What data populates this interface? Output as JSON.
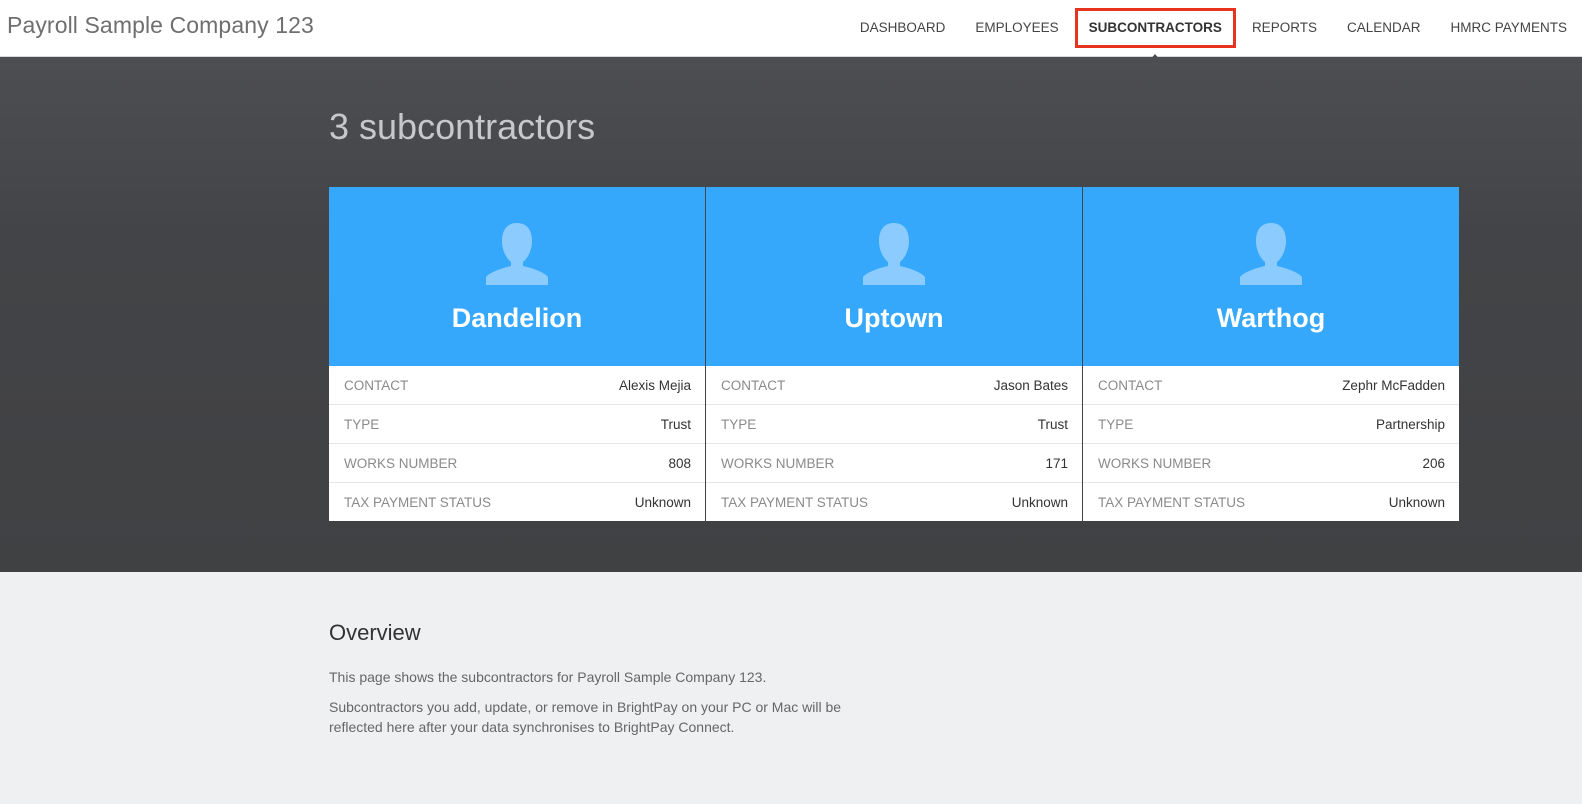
{
  "header": {
    "company_title": "Payroll Sample Company 123",
    "nav": [
      {
        "label": "DASHBOARD"
      },
      {
        "label": "EMPLOYEES"
      },
      {
        "label": "SUBCONTRACTORS"
      },
      {
        "label": "REPORTS"
      },
      {
        "label": "CALENDAR"
      },
      {
        "label": "HMRC PAYMENTS"
      }
    ],
    "active_nav": "SUBCONTRACTORS"
  },
  "main": {
    "heading": "3 subcontractors",
    "avatar_icon": "user-silhouette-icon",
    "cards": [
      {
        "name": "Dandelion",
        "rows": [
          {
            "label": "CONTACT",
            "value": "Alexis Mejia"
          },
          {
            "label": "TYPE",
            "value": "Trust"
          },
          {
            "label": "WORKS NUMBER",
            "value": "808"
          },
          {
            "label": "TAX PAYMENT STATUS",
            "value": "Unknown"
          }
        ]
      },
      {
        "name": "Uptown",
        "rows": [
          {
            "label": "CONTACT",
            "value": "Jason Bates"
          },
          {
            "label": "TYPE",
            "value": "Trust"
          },
          {
            "label": "WORKS NUMBER",
            "value": "171"
          },
          {
            "label": "TAX PAYMENT STATUS",
            "value": "Unknown"
          }
        ]
      },
      {
        "name": "Warthog",
        "rows": [
          {
            "label": "CONTACT",
            "value": "Zephr McFadden"
          },
          {
            "label": "TYPE",
            "value": "Partnership"
          },
          {
            "label": "WORKS NUMBER",
            "value": "206"
          },
          {
            "label": "TAX PAYMENT STATUS",
            "value": "Unknown"
          }
        ]
      }
    ]
  },
  "overview": {
    "title": "Overview",
    "paragraph_1": "This page shows the subcontractors for Payroll Sample Company 123.",
    "paragraph_2": "Subcontractors you add, update, or remove in BrightPay on your PC or Mac will be reflected here after your data synchronises to BrightPay Connect."
  },
  "colors": {
    "card_header": "#36a8fc",
    "active_outline": "#e8331e",
    "dark_band": "#434447"
  }
}
